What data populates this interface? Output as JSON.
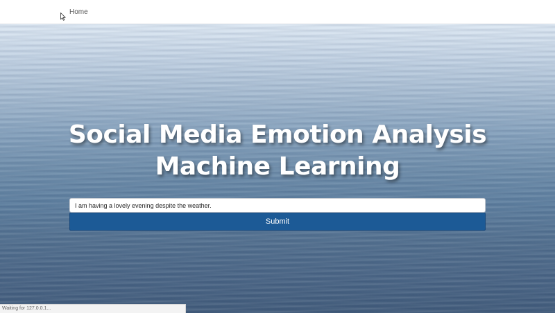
{
  "navbar": {
    "home_label": "Home"
  },
  "hero": {
    "title_line_1": "Social Media Emotion Analysis",
    "title_line_2": "Machine Learning"
  },
  "form": {
    "input_value": "I am having a lovely evening despite the weather.",
    "submit_label": "Submit"
  },
  "status_bar": {
    "text": "Waiting for 127.0.0.1..."
  },
  "colors": {
    "submit_button": "#1c5a96",
    "hero_text": "#ffffff"
  },
  "icons": {
    "pointer": "mouse-pointer-icon"
  }
}
